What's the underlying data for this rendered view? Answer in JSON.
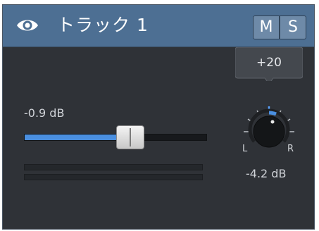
{
  "track": {
    "name": "トラック 1",
    "mute_label": "M",
    "solo_label": "S"
  },
  "volume": {
    "label": "-0.9 dB",
    "position": 0.58
  },
  "pan": {
    "tooltip": "+20",
    "left_label": "L",
    "right_label": "R",
    "db_label": "-4.2 dB"
  },
  "icons": {
    "visibility": "eye-icon"
  },
  "colors": {
    "header": "#4d6f93",
    "accent": "#4a8fe0",
    "panel": "#2f3237"
  }
}
